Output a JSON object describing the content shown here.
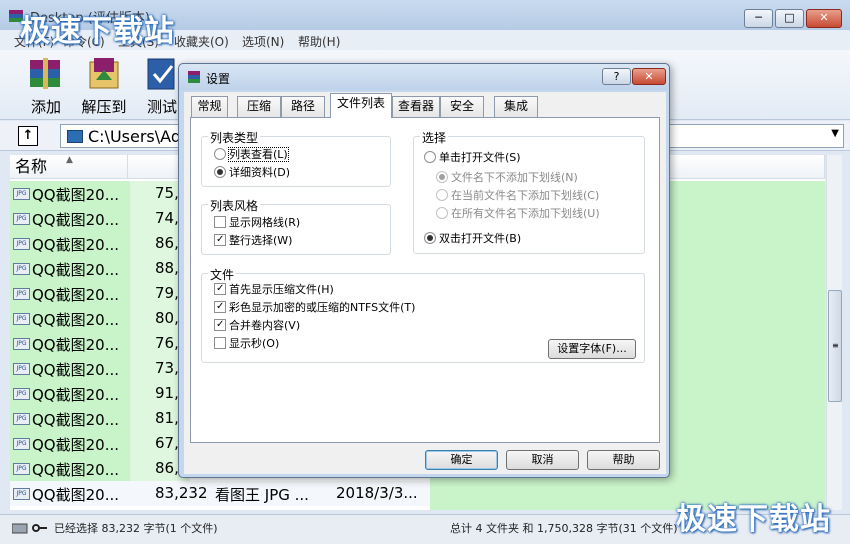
{
  "main_window": {
    "title": "Desktop (评估版本)",
    "menu": [
      "文件(F)",
      "命令(C)",
      "工具(S)",
      "收藏夹(O)",
      "选项(N)",
      "帮助(H)"
    ],
    "toolbar": [
      "添加",
      "解压到",
      "测试"
    ],
    "path": "C:\\Users\\Adı",
    "columns": {
      "name": "名称",
      "size": "大"
    },
    "files": [
      {
        "name": "QQ截图20...",
        "size": "75,3"
      },
      {
        "name": "QQ截图20...",
        "size": "74,1"
      },
      {
        "name": "QQ截图20...",
        "size": "86,3"
      },
      {
        "name": "QQ截图20...",
        "size": "88,0"
      },
      {
        "name": "QQ截图20...",
        "size": "79,3"
      },
      {
        "name": "QQ截图20...",
        "size": "80,3"
      },
      {
        "name": "QQ截图20...",
        "size": "76,3"
      },
      {
        "name": "QQ截图20...",
        "size": "73,9"
      },
      {
        "name": "QQ截图20...",
        "size": "91,4"
      },
      {
        "name": "QQ截图20...",
        "size": "81,8"
      },
      {
        "name": "QQ截图20...",
        "size": "67,4"
      },
      {
        "name": "QQ截图20...",
        "size": "86,4"
      },
      {
        "name": "QQ截图20...",
        "size": "83,232",
        "type": "看图王 JPG ...",
        "date": "2018/3/3..."
      }
    ],
    "file_badge": "JPG",
    "status_left": "已经选择 83,232 字节(1 个文件)",
    "status_right": "总计 4 文件夹 和 1,750,328 字节(31 个文件)"
  },
  "watermark": "极速下载站",
  "dialog": {
    "title": "设置",
    "help_btn": "?",
    "tabs": [
      "常规",
      "压缩",
      "路径",
      "文件列表",
      "查看器",
      "安全",
      "集成"
    ],
    "active_tab": 3,
    "list_type": {
      "title": "列表类型",
      "options": [
        {
          "label": "列表查看(L)",
          "selected": false
        },
        {
          "label": "详细资料(D)",
          "selected": true
        }
      ]
    },
    "list_style": {
      "title": "列表风格",
      "options": [
        {
          "label": "显示网格线(R)",
          "checked": false
        },
        {
          "label": "整行选择(W)",
          "checked": true
        }
      ]
    },
    "select": {
      "title": "选择",
      "single": {
        "label": "单击打开文件(S)",
        "selected": false
      },
      "sub_options": [
        {
          "label": "文件名下不添加下划线(N)",
          "selected": true
        },
        {
          "label": "在当前文件名下添加下划线(C)",
          "selected": false
        },
        {
          "label": "在所有文件名下添加下划线(U)",
          "selected": false
        }
      ],
      "double": {
        "label": "双击打开文件(B)",
        "selected": true
      }
    },
    "files": {
      "title": "文件",
      "options": [
        {
          "label": "首先显示压缩文件(H)",
          "checked": true
        },
        {
          "label": "彩色显示加密的或压缩的NTFS文件(T)",
          "checked": true
        },
        {
          "label": "合并卷内容(V)",
          "checked": true
        },
        {
          "label": "显示秒(O)",
          "checked": false
        }
      ],
      "font_button": "设置字体(F)..."
    },
    "buttons": {
      "ok": "确定",
      "cancel": "取消",
      "help": "帮助"
    }
  },
  "colors": {
    "list_green": "#c9f3c9",
    "dialog_frame": "#c5d7ec",
    "close_red": "#c74a33"
  }
}
